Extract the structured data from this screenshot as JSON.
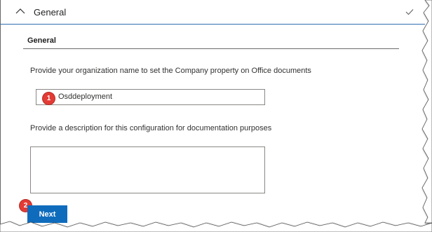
{
  "accordion": {
    "title": "General"
  },
  "panel": {
    "heading": "General",
    "org_label": "Provide your organization name to set the Company property on Office documents",
    "org_value": "Osddeployment",
    "desc_label": "Provide a description for this configuration for documentation purposes",
    "desc_value": "",
    "next_label": "Next"
  },
  "badges": {
    "first": "1",
    "second": "2"
  },
  "colors": {
    "accent": "#0f6cbd",
    "badge": "#e33b35"
  },
  "icons": {
    "collapse": "chevron-up-icon",
    "done": "checkmark-icon"
  }
}
